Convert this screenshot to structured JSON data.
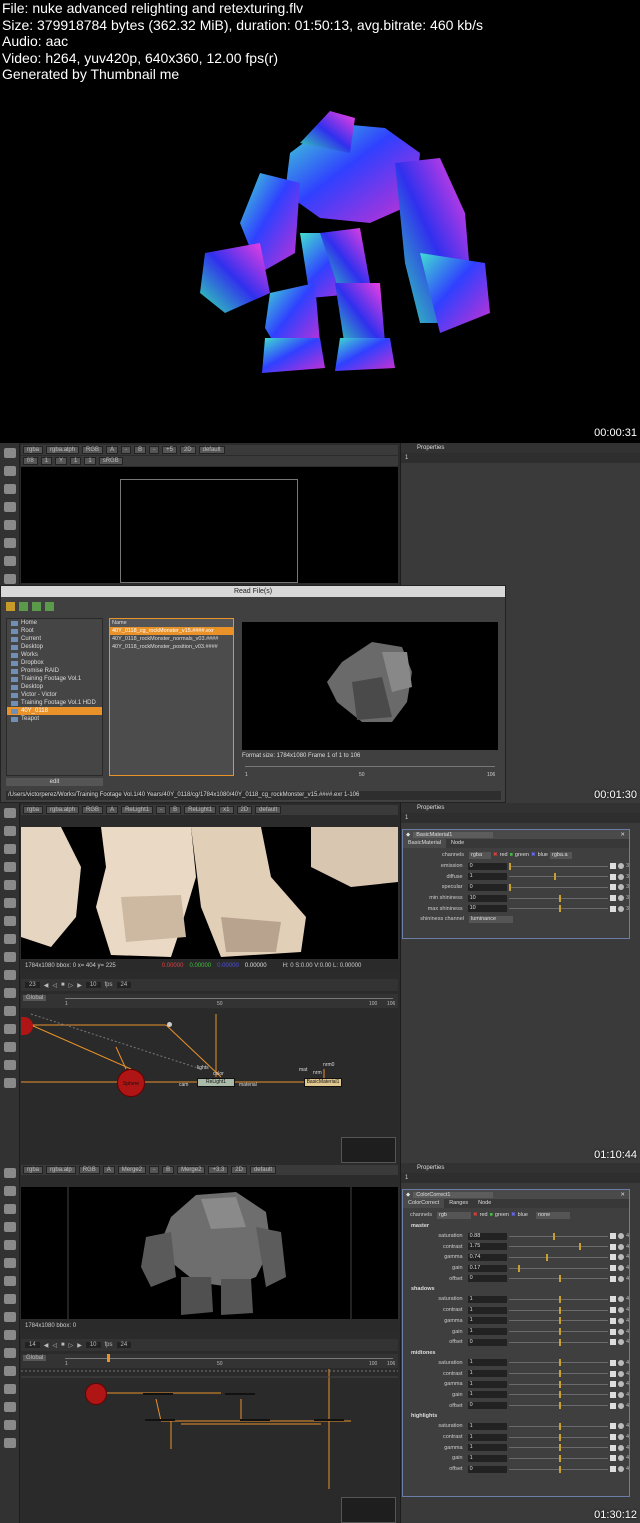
{
  "header": {
    "file": "File: nuke advanced relighting and retexturing.flv",
    "size": "Size: 379918784 bytes (362.32 MiB), duration: 01:50:13, avg.bitrate: 460 kb/s",
    "audio": "Audio: aac",
    "video": "Video: h264, yuv420p, 640x360, 12.00 fps(r)",
    "generated": "Generated by Thumbnail me"
  },
  "timestamps": [
    "00:00:31",
    "00:01:30",
    "01:10:44",
    "01:30:12"
  ],
  "properties_label": "Properties",
  "frame2": {
    "viewer_bar": [
      "rgba",
      "rgba.alph",
      "RGB",
      "A",
      "-",
      "B",
      "-",
      "+5",
      "2D",
      "default"
    ],
    "viewer_bar2": [
      "f/8",
      "1",
      "Y",
      "1",
      "1",
      "sRGB"
    ],
    "dialog": {
      "title": "Read File(s)",
      "places": [
        "Home",
        "Root",
        "Current",
        "Desktop",
        "Works",
        "Dropbox",
        "Promise RAID",
        "Training Footage Vol.1",
        "Desktop",
        "Victor - Victor",
        "Training Footage Vol.1 HDD",
        "40Y_0118",
        "Teapot"
      ],
      "selected_place": "40Y_0118",
      "edit_label": "edit",
      "list_header": "Name",
      "files": [
        "40Y_0118_cg_rockMonster_v15.####.exr",
        "40Y_0118_rockMonster_normals_v03.####",
        "40Y_0118_rockMonster_position_v03.####"
      ],
      "format": "Format size: 1784x1080   Frame 1 of 1 to 106",
      "ticks": [
        "1",
        "50",
        "106"
      ],
      "path": "/Users/victorperez/Works/Training Footage Vol.1/40 Years/40Y_0118/cg/1784x1080/40Y_0118_cg_rockMonster_v15.####.exr 1-106"
    }
  },
  "frame3": {
    "viewer_bar": [
      "rgba",
      "rgba.alph",
      "RGB",
      "A",
      "ReLight1",
      "-",
      "B",
      "ReLight1",
      "x1",
      "2D",
      "default"
    ],
    "status": "1784x1080  bbox: 0   x= 404 y= 225",
    "status_vals": [
      "0.00000",
      "0.00000",
      "0.00000",
      "0.00000"
    ],
    "status_right": "H:  0 S:0.00 V:0.00  L: 0.00000",
    "frame": "23",
    "fps_label": "fps",
    "fps": "24",
    "step": "10",
    "global": "Global",
    "ticks": [
      "1",
      "50",
      "100",
      "106"
    ],
    "node_name": "BasicMaterial1",
    "tabs": [
      "BasicMaterial",
      "Node"
    ],
    "channels": "rgba",
    "channel_flags": [
      "red",
      "green",
      "blue"
    ],
    "alpha": "rgba.a",
    "params": [
      {
        "label": "emission",
        "value": "0",
        "knob": 0.0
      },
      {
        "label": "diffuse",
        "value": "1",
        "knob": 0.45
      },
      {
        "label": "specular",
        "value": "0",
        "knob": 0.0
      },
      {
        "label": "min shininess",
        "value": "10",
        "knob": 0.5
      },
      {
        "label": "max shininess",
        "value": "10",
        "knob": 0.5
      }
    ],
    "param_num": "3",
    "shininess_label": "shininess channel",
    "shininess_value": "luminance",
    "nodes": {
      "sphere": "Sphere",
      "relight": "ReLight1",
      "material": "BasicMaterial1",
      "lights": "lights",
      "cam": "cam",
      "color": "color",
      "material_in": "material",
      "mat": "mat",
      "nrm": "nrm",
      "nrm0": "nrm0"
    }
  },
  "frame4": {
    "viewer_bar": [
      "rgba",
      "rgba.alp",
      "RGB",
      "A",
      "Merge2",
      "-",
      "B",
      "Merge2",
      "+3.3",
      "2D",
      "default"
    ],
    "status": "1784x1080  bbox: 0",
    "frame": "14",
    "fps_label": "fps",
    "fps": "24",
    "step": "10",
    "global": "Global",
    "ticks": [
      "1",
      "50",
      "100",
      "106"
    ],
    "node_name": "ColorCorrect1",
    "tabs": [
      "ColorCorrect",
      "Ranges",
      "Node"
    ],
    "channels": "rgb",
    "channel_flags": [
      "red",
      "green",
      "blue"
    ],
    "mask": "none",
    "param_num": "4",
    "sections": [
      {
        "name": "master",
        "params": [
          {
            "label": "saturation",
            "value": "0.88",
            "knob": 0.44
          },
          {
            "label": "contrast",
            "value": "1.75",
            "knob": 0.7
          },
          {
            "label": "gamma",
            "value": "0.74",
            "knob": 0.37
          },
          {
            "label": "gain",
            "value": "0.17",
            "knob": 0.09
          },
          {
            "label": "offset",
            "value": "0",
            "knob": 0.5
          }
        ]
      },
      {
        "name": "shadows",
        "params": [
          {
            "label": "saturation",
            "value": "1",
            "knob": 0.5
          },
          {
            "label": "contrast",
            "value": "1",
            "knob": 0.5
          },
          {
            "label": "gamma",
            "value": "1",
            "knob": 0.5
          },
          {
            "label": "gain",
            "value": "1",
            "knob": 0.5
          },
          {
            "label": "offset",
            "value": "0",
            "knob": 0.5
          }
        ]
      },
      {
        "name": "midtones",
        "params": [
          {
            "label": "saturation",
            "value": "1",
            "knob": 0.5
          },
          {
            "label": "contrast",
            "value": "1",
            "knob": 0.5
          },
          {
            "label": "gamma",
            "value": "1",
            "knob": 0.5
          },
          {
            "label": "gain",
            "value": "1",
            "knob": 0.5
          },
          {
            "label": "offset",
            "value": "0",
            "knob": 0.5
          }
        ]
      },
      {
        "name": "highlights",
        "params": [
          {
            "label": "saturation",
            "value": "1",
            "knob": 0.5
          },
          {
            "label": "contrast",
            "value": "1",
            "knob": 0.5
          },
          {
            "label": "gamma",
            "value": "1",
            "knob": 0.5
          },
          {
            "label": "gain",
            "value": "1",
            "knob": 0.5
          },
          {
            "label": "offset",
            "value": "0",
            "knob": 0.5
          }
        ]
      }
    ]
  },
  "colors": {
    "accent": "#e9922a",
    "node_sel": "#c8a030",
    "sphere": "#b01515",
    "panel": "#3a3a3a"
  }
}
